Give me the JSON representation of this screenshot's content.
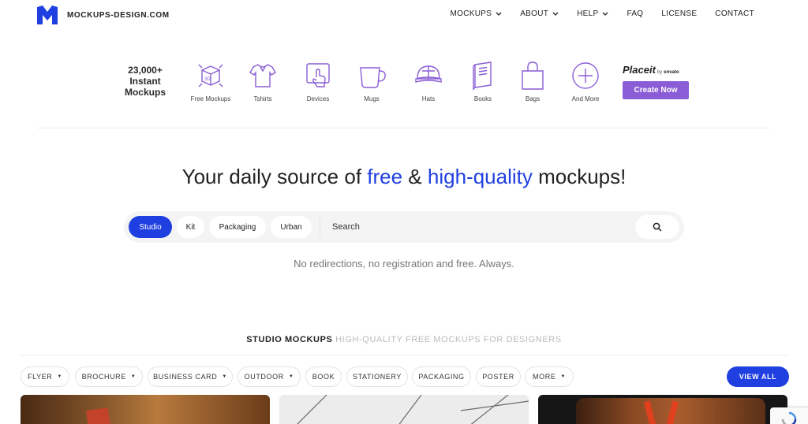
{
  "header": {
    "logo_text": "MOCKUPS-DESIGN.COM",
    "nav": [
      {
        "label": "MOCKUPS",
        "dropdown": true
      },
      {
        "label": "ABOUT",
        "dropdown": true
      },
      {
        "label": "HELP",
        "dropdown": true
      },
      {
        "label": "FAQ",
        "dropdown": false
      },
      {
        "label": "LICENSE",
        "dropdown": false
      },
      {
        "label": "CONTACT",
        "dropdown": false
      }
    ]
  },
  "banner": {
    "count_line1": "23,000+",
    "count_line2": "Instant",
    "count_line3": "Mockups",
    "categories": [
      {
        "label": "Free Mockups",
        "icon": "box-3d-icon"
      },
      {
        "label": "Tshirts",
        "icon": "tshirt-icon"
      },
      {
        "label": "Devices",
        "icon": "tablet-touch-icon"
      },
      {
        "label": "Mugs",
        "icon": "mug-icon"
      },
      {
        "label": "Hats",
        "icon": "cap-icon"
      },
      {
        "label": "Books",
        "icon": "book-icon"
      },
      {
        "label": "Bags",
        "icon": "shopping-bag-icon"
      },
      {
        "label": "And More",
        "icon": "plus-circle-icon"
      }
    ],
    "placeit": {
      "name": "Placeit",
      "by": "by",
      "envato": "envato"
    },
    "cta_label": "Create Now",
    "cta_color": "#8a5dd6"
  },
  "hero": {
    "heading_part1": "Your daily source of ",
    "heading_highlight1": "free",
    "heading_part2": " & ",
    "heading_highlight2": "high-quality",
    "heading_part3": " mockups!",
    "highlight_color": "#1f3fe0"
  },
  "search": {
    "chips": [
      {
        "label": "Studio",
        "active": true
      },
      {
        "label": "Kit",
        "active": false
      },
      {
        "label": "Packaging",
        "active": false
      },
      {
        "label": "Urban",
        "active": false
      }
    ],
    "placeholder": "Search",
    "tagline": "No redirections, no registration and free. Always."
  },
  "section": {
    "title_bold": "STUDIO MOCKUPS",
    "title_light": "HIGH-QUALITY FREE MOCKUPS FOR DESIGNERS",
    "filters": [
      {
        "label": "FLYER",
        "dropdown": true
      },
      {
        "label": "BROCHURE",
        "dropdown": true
      },
      {
        "label": "BUSINESS CARD",
        "dropdown": true
      },
      {
        "label": "OUTDOOR",
        "dropdown": true
      },
      {
        "label": "BOOK",
        "dropdown": false
      },
      {
        "label": "STATIONERY",
        "dropdown": false
      },
      {
        "label": "PACKAGING",
        "dropdown": false
      },
      {
        "label": "POSTER",
        "dropdown": false
      },
      {
        "label": "MORE",
        "dropdown": true
      }
    ],
    "view_all_label": "VIEW ALL",
    "accent_color": "#1f3fe0"
  }
}
